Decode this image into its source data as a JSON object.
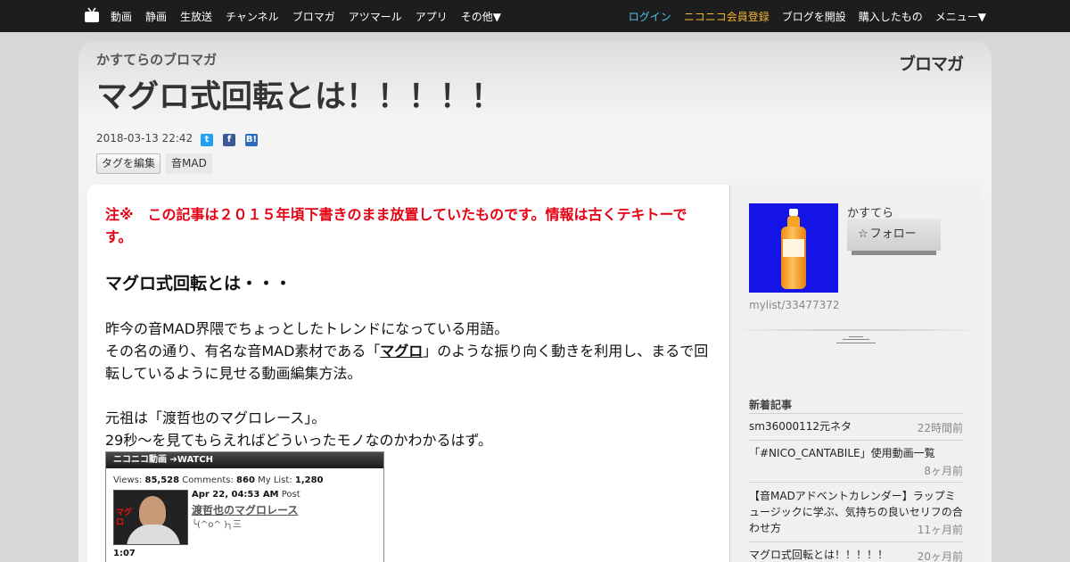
{
  "nav": {
    "left": [
      "動画",
      "静画",
      "生放送",
      "チャンネル",
      "ブロマガ",
      "アツマール",
      "アプリ",
      "その他▼"
    ],
    "login": "ログイン",
    "register": "ニコニコ会員登録",
    "open_blog": "ブログを開設",
    "purchased": "購入したもの",
    "menu": "メニュー▼"
  },
  "header": {
    "blog_name": "かすてらのブロマガ",
    "logo": "ブロマガ",
    "title": "マグロ式回転とは！！！！！",
    "date": "2018-03-13 22:42",
    "share": {
      "twitter": "t",
      "facebook": "f",
      "hatena": "B!"
    },
    "tag_edit": "タグを編集",
    "tags": [
      "音MAD"
    ]
  },
  "article": {
    "notice": "注※　この記事は２０１５年頃下書きのまま放置していたものです。情報は古くテキトーです。",
    "heading": "マグロ式回転とは・・・",
    "para1": "昨今の音MAD界隈でちょっとしたトレンドになっている用語。",
    "para2_pre": "その名の通り、有名な音MAD素材である「",
    "para2_link": "マグロ",
    "para2_post": "」のような振り向く動きを利用し、まるで回転しているように見せる動画編集方法。",
    "para3": "元祖は「渡哲也のマグロレース」。",
    "para4": "29秒～を見てもらえればどういったモノなのかわかるはず。"
  },
  "embed": {
    "header": "ニコニコ動画 ➔WATCH",
    "views_label": "Views:",
    "views": "85,528",
    "comments_label": "Comments:",
    "comments": "860",
    "mylist_label": "My List:",
    "mylist": "1,280",
    "date": "Apr 22, 04:53 AM",
    "post_label": "Post",
    "title": "渡哲也のマグロレース",
    "desc": "╰(^o^ )╮三",
    "thumb_text": "マグロ",
    "length": "1:07"
  },
  "sidebar": {
    "author": "かすてら",
    "follow": "フォロー",
    "mylist": "mylist/33477372",
    "recent_heading": "新着記事",
    "recent": [
      {
        "title": "sm36000112元ネタ",
        "time": "22時間前"
      },
      {
        "title": "「#NICO_CANTABILE」使用動画一覧",
        "time": "8ヶ月前"
      },
      {
        "title": "【音MADアドベントカレンダー】ラップミュージックに学ぶ、気持ちの良いセリフの合わせ方",
        "time": "11ヶ月前"
      },
      {
        "title": "マグロ式回転とは！！！！！",
        "time": "20ヶ月前"
      }
    ]
  },
  "colors": {
    "topbar": "#1d1d1d",
    "login": "#4fc4ef",
    "register": "#f2b531",
    "notice": "#e60012",
    "avatar_bg": "#1414e6"
  }
}
